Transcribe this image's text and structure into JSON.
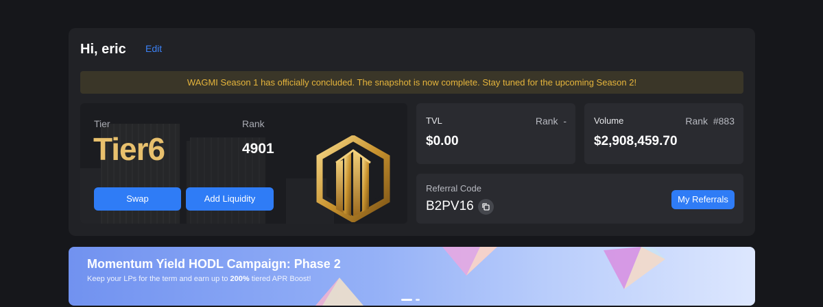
{
  "header": {
    "greeting": "Hi, eric",
    "edit_label": "Edit"
  },
  "banner": {
    "text": "WAGMI Season 1 has officially concluded. The snapshot is now complete. Stay tuned for the upcoming Season 2!"
  },
  "tier_card": {
    "tier_label": "Tier",
    "tier_value": "Tier6",
    "rank_label": "Rank",
    "rank_value": "4901",
    "swap_label": "Swap",
    "add_liquidity_label": "Add Liquidity",
    "emblem_icon": "gold-building-hexagon-emblem"
  },
  "tvl": {
    "label": "TVL",
    "rank_label": "Rank",
    "rank_value": "-",
    "value": "$0.00"
  },
  "volume": {
    "label": "Volume",
    "rank_label": "Rank",
    "rank_value": "#883",
    "value": "$2,908,459.70"
  },
  "referral": {
    "label": "Referral Code",
    "code": "B2PV16",
    "copy_icon": "copy-icon",
    "my_referrals_label": "My Referrals"
  },
  "promo": {
    "title": "Momentum Yield HODL Campaign: Phase 2",
    "subtitle_prefix": "Keep your LPs for the term and earn up to ",
    "subtitle_highlight": "200%",
    "subtitle_suffix": " tiered APR Boost!",
    "slides": 2,
    "active_slide": 1
  },
  "colors": {
    "accent": "#2f7cf6",
    "gold": "#e8c06d",
    "banner_text": "#e6b53c",
    "background": "#16171b",
    "card": "#212226"
  }
}
